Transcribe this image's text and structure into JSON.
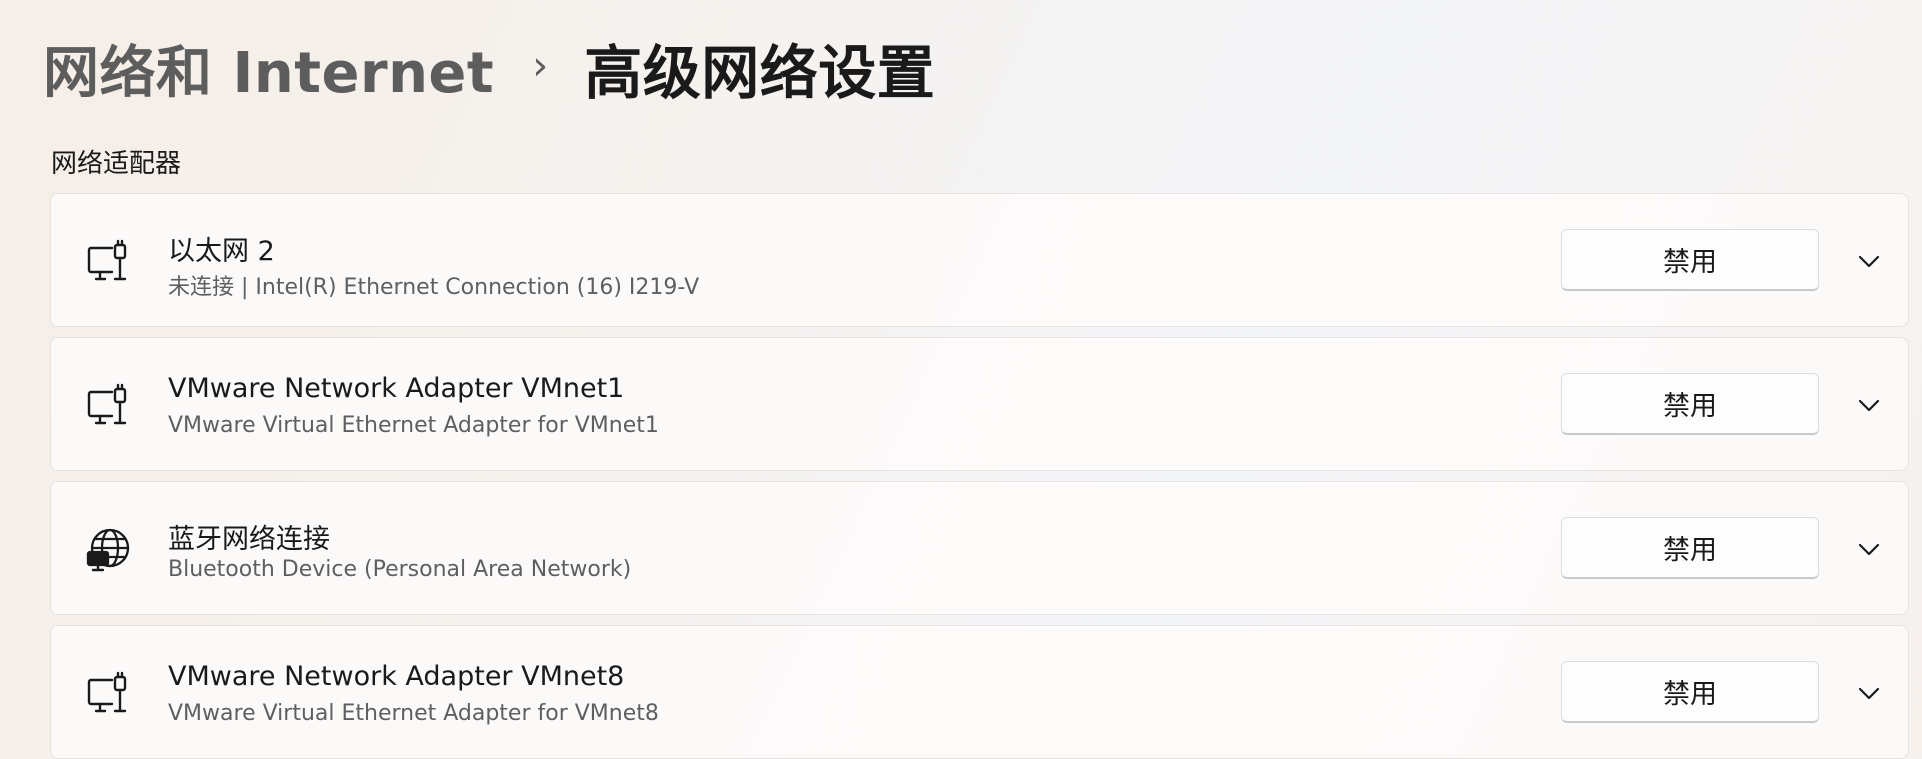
{
  "breadcrumb": {
    "parent": "网络和 Internet",
    "separator": "›",
    "current": "高级网络设置"
  },
  "section": {
    "title": "网络适配器"
  },
  "adapters": [
    {
      "icon": "ethernet-computer-icon",
      "title": "以太网 2",
      "subtitle": "未连接 | Intel(R) Ethernet Connection (16) I219-V",
      "button_label": "禁用"
    },
    {
      "icon": "ethernet-computer-icon",
      "title": "VMware Network Adapter VMnet1",
      "subtitle": "VMware Virtual Ethernet Adapter for VMnet1",
      "button_label": "禁用"
    },
    {
      "icon": "globe-network-icon",
      "title": "蓝牙网络连接",
      "subtitle": "Bluetooth Device (Personal Area Network)",
      "button_label": "禁用"
    },
    {
      "icon": "ethernet-computer-icon",
      "title": "VMware Network Adapter VMnet8",
      "subtitle": "VMware Virtual Ethernet Adapter for VMnet8",
      "button_label": "禁用"
    }
  ]
}
